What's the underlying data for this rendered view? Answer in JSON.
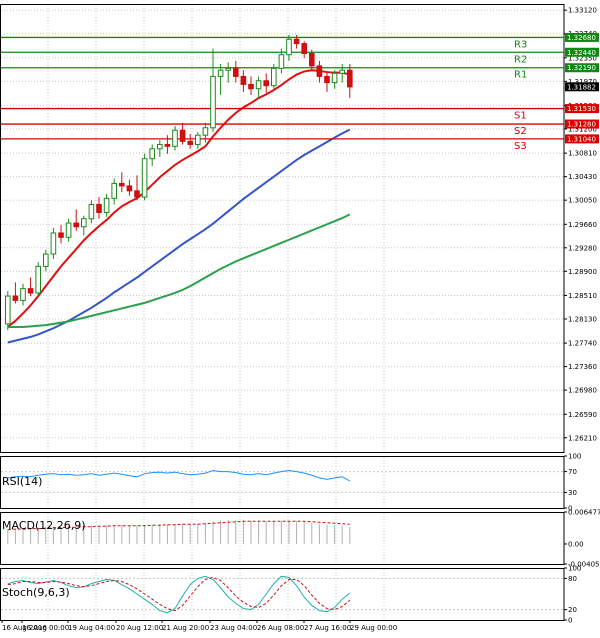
{
  "chart_data": [
    {
      "type": "candlestick",
      "name_hidden": true,
      "price_axis": {
        "ylim": [
          1.2598,
          1.3322
        ],
        "ticks": [
          "1.33120",
          "1.32740",
          "1.32350",
          "1.31970",
          "1.31580",
          "1.31200",
          "1.30810",
          "1.30430",
          "1.30050",
          "1.29660",
          "1.29280",
          "1.28900",
          "1.28510",
          "1.28130",
          "1.27740",
          "1.27360",
          "1.26980",
          "1.26590",
          "1.26210"
        ]
      },
      "levels": [
        {
          "label": "R3",
          "value": 1.3268,
          "tag": "1.32680",
          "kind": "resistance"
        },
        {
          "label": "R2",
          "value": 1.3244,
          "tag": "1.32440",
          "kind": "resistance"
        },
        {
          "label": "R1",
          "value": 1.3219,
          "tag": "1.32190",
          "kind": "resistance"
        },
        {
          "label": "S1",
          "value": 1.3153,
          "tag": "1.31530",
          "kind": "support"
        },
        {
          "label": "S2",
          "value": 1.3128,
          "tag": "1.31280",
          "kind": "support"
        },
        {
          "label": "S3",
          "value": 1.3104,
          "tag": "1.31040",
          "kind": "support"
        }
      ],
      "current_price": {
        "value": 1.31882,
        "tag": "1.31882"
      },
      "time_axis": [
        "16 Aug 2016",
        "16 Aug 00:00",
        "19 Aug 04:00",
        "20 Aug 12:00",
        "21 Aug 20:00",
        "23 Aug 04:00",
        "26 Aug 08:00",
        "27 Aug 16:00",
        "29 Aug 00:00"
      ],
      "colors": {
        "bull": "#1c8a1c",
        "bear": "#cc1111",
        "ma_fast": "#e01010",
        "ma_mid": "#3355cc",
        "ma_slow": "#2ca04c",
        "resistance": "#118811",
        "support": "#dd0000",
        "grid": "#c8c8c8"
      },
      "ohlc": [
        [
          1.2805,
          1.2858,
          1.2795,
          1.285
        ],
        [
          1.285,
          1.2872,
          1.2838,
          1.2843
        ],
        [
          1.2843,
          1.287,
          1.2835,
          1.2862
        ],
        [
          1.2862,
          1.288,
          1.285,
          1.2855
        ],
        [
          1.2855,
          1.2905,
          1.285,
          1.2898
        ],
        [
          1.2898,
          1.2925,
          1.289,
          1.2918
        ],
        [
          1.2918,
          1.296,
          1.291,
          1.2952
        ],
        [
          1.2952,
          1.2965,
          1.2935,
          1.2945
        ],
        [
          1.2945,
          1.2975,
          1.2938,
          1.2968
        ],
        [
          1.2968,
          1.299,
          1.2955,
          1.2962
        ],
        [
          1.2962,
          1.298,
          1.2948,
          1.2975
        ],
        [
          1.2975,
          1.3005,
          1.2968,
          1.2998
        ],
        [
          1.2998,
          1.301,
          1.2975,
          1.2985
        ],
        [
          1.2985,
          1.3015,
          1.2978,
          1.3008
        ],
        [
          1.3008,
          1.304,
          1.2998,
          1.3032
        ],
        [
          1.3032,
          1.305,
          1.3018,
          1.3028
        ],
        [
          1.3028,
          1.3038,
          1.3012,
          1.302
        ],
        [
          1.302,
          1.3045,
          1.3005,
          1.301
        ],
        [
          1.301,
          1.308,
          1.3005,
          1.3072
        ],
        [
          1.3072,
          1.3095,
          1.306,
          1.3088
        ],
        [
          1.3088,
          1.3102,
          1.3075,
          1.3095
        ],
        [
          1.3095,
          1.311,
          1.308,
          1.3092
        ],
        [
          1.3092,
          1.3125,
          1.3085,
          1.3118
        ],
        [
          1.3118,
          1.313,
          1.3095,
          1.31
        ],
        [
          1.31,
          1.3112,
          1.3088,
          1.3095
        ],
        [
          1.3095,
          1.3115,
          1.3088,
          1.311
        ],
        [
          1.311,
          1.313,
          1.3098,
          1.3122
        ],
        [
          1.3122,
          1.325,
          1.3115,
          1.3205
        ],
        [
          1.3205,
          1.3225,
          1.3175,
          1.3215
        ],
        [
          1.3215,
          1.3228,
          1.3195,
          1.3218
        ],
        [
          1.3218,
          1.323,
          1.3195,
          1.3205
        ],
        [
          1.3205,
          1.3215,
          1.318,
          1.3192
        ],
        [
          1.3192,
          1.3205,
          1.3175,
          1.3185
        ],
        [
          1.3185,
          1.3205,
          1.317,
          1.3198
        ],
        [
          1.3198,
          1.321,
          1.3178,
          1.319
        ],
        [
          1.319,
          1.3225,
          1.3185,
          1.3218
        ],
        [
          1.3218,
          1.325,
          1.321,
          1.324
        ],
        [
          1.324,
          1.3272,
          1.323,
          1.3265
        ],
        [
          1.3265,
          1.3272,
          1.325,
          1.3258
        ],
        [
          1.3258,
          1.3262,
          1.3235,
          1.3242
        ],
        [
          1.3242,
          1.3248,
          1.3215,
          1.3222
        ],
        [
          1.3222,
          1.323,
          1.3195,
          1.3205
        ],
        [
          1.3205,
          1.3212,
          1.318,
          1.3195
        ],
        [
          1.3195,
          1.3215,
          1.3185,
          1.321
        ],
        [
          1.321,
          1.3225,
          1.3195,
          1.3215
        ],
        [
          1.3215,
          1.3225,
          1.317,
          1.3188
        ]
      ],
      "ma_fast": [
        1.28,
        1.281,
        1.2822,
        1.2835,
        1.285,
        1.2866,
        1.2882,
        1.2898,
        1.2912,
        1.2926,
        1.294,
        1.2952,
        1.2963,
        1.2973,
        1.2985,
        1.2995,
        1.3002,
        1.3008,
        1.3018,
        1.303,
        1.3042,
        1.3052,
        1.3062,
        1.307,
        1.3077,
        1.3084,
        1.3092,
        1.3108,
        1.3122,
        1.3135,
        1.3146,
        1.3155,
        1.3162,
        1.317,
        1.3176,
        1.3183,
        1.3191,
        1.32,
        1.3208,
        1.3213,
        1.3215,
        1.3214,
        1.3212,
        1.3211,
        1.3211,
        1.3208
      ],
      "ma_mid": [
        1.2775,
        1.2778,
        1.2781,
        1.2784,
        1.2788,
        1.2793,
        1.2798,
        1.2804,
        1.281,
        1.2817,
        1.2824,
        1.2831,
        1.2839,
        1.2847,
        1.2856,
        1.2864,
        1.2872,
        1.288,
        1.2889,
        1.2898,
        1.2907,
        1.2916,
        1.2925,
        1.2934,
        1.2942,
        1.295,
        1.2958,
        1.2967,
        1.2977,
        1.2987,
        1.2997,
        1.3007,
        1.3016,
        1.3025,
        1.3034,
        1.3043,
        1.3052,
        1.3061,
        1.307,
        1.3078,
        1.3085,
        1.3092,
        1.3099,
        1.3106,
        1.3113,
        1.3119
      ],
      "ma_slow": [
        1.28,
        1.28,
        1.28,
        1.2801,
        1.2802,
        1.2803,
        1.2805,
        1.2807,
        1.2809,
        1.2812,
        1.2815,
        1.2818,
        1.2821,
        1.2824,
        1.2827,
        1.283,
        1.2833,
        1.2836,
        1.2839,
        1.2843,
        1.2847,
        1.2851,
        1.2855,
        1.286,
        1.2866,
        1.2873,
        1.288,
        1.2887,
        1.2894,
        1.29,
        1.2906,
        1.2911,
        1.2916,
        1.2921,
        1.2926,
        1.2931,
        1.2936,
        1.2941,
        1.2946,
        1.2951,
        1.2956,
        1.2961,
        1.2966,
        1.2971,
        1.2976,
        1.2982
      ]
    },
    {
      "type": "line",
      "title": "RSI(14)",
      "ticks": [
        "100",
        "70",
        "30",
        "0"
      ],
      "ylim": [
        0,
        100
      ],
      "values": [
        58,
        60,
        61,
        60,
        63,
        65,
        66,
        64,
        65,
        63,
        64,
        66,
        63,
        65,
        67,
        65,
        62,
        60,
        66,
        68,
        69,
        67,
        69,
        66,
        64,
        65,
        67,
        72,
        70,
        70,
        68,
        65,
        64,
        66,
        64,
        67,
        70,
        72,
        70,
        67,
        63,
        58,
        55,
        58,
        60,
        52
      ]
    },
    {
      "type": "bar",
      "title": "MACD(12,26,9)",
      "ticks": [
        "0.006477",
        "0.00",
        "-0.004058"
      ],
      "ylim": [
        -0.004058,
        0.006477
      ],
      "values": [
        0.003,
        0.0031,
        0.0032,
        0.0032,
        0.0033,
        0.0034,
        0.0035,
        0.0035,
        0.0036,
        0.0036,
        0.0037,
        0.0037,
        0.0037,
        0.0038,
        0.0038,
        0.0038,
        0.0037,
        0.0037,
        0.0038,
        0.0039,
        0.004,
        0.004,
        0.0041,
        0.0041,
        0.0041,
        0.0041,
        0.0042,
        0.0045,
        0.0047,
        0.0048,
        0.0048,
        0.0048,
        0.0047,
        0.0047,
        0.0046,
        0.0046,
        0.0046,
        0.0047,
        0.0046,
        0.0045,
        0.0043,
        0.0041,
        0.0039,
        0.0038,
        0.0037,
        0.0035
      ],
      "signal": [
        0.0029,
        0.003,
        0.003,
        0.0031,
        0.0031,
        0.0032,
        0.0033,
        0.0033,
        0.0034,
        0.0034,
        0.0035,
        0.0035,
        0.0036,
        0.0036,
        0.0037,
        0.0037,
        0.0037,
        0.0037,
        0.0037,
        0.0038,
        0.0038,
        0.0039,
        0.0039,
        0.004,
        0.004,
        0.004,
        0.0041,
        0.0042,
        0.0043,
        0.0044,
        0.0045,
        0.0046,
        0.0046,
        0.0046,
        0.0046,
        0.0046,
        0.0046,
        0.0046,
        0.0046,
        0.0046,
        0.0045,
        0.0044,
        0.0043,
        0.0042,
        0.0041,
        0.004
      ]
    },
    {
      "type": "line",
      "title": "Stoch(9,6,3)",
      "ticks": [
        "100",
        "80",
        "20",
        "0"
      ],
      "ylim": [
        0,
        100
      ],
      "main": [
        70,
        74,
        76,
        72,
        70,
        73,
        76,
        72,
        66,
        62,
        64,
        70,
        74,
        78,
        76,
        68,
        60,
        50,
        40,
        30,
        18,
        14,
        22,
        46,
        68,
        80,
        84,
        78,
        62,
        44,
        32,
        22,
        20,
        30,
        50,
        70,
        84,
        82,
        66,
        44,
        28,
        18,
        16,
        24,
        40,
        52
      ],
      "signal": [
        68,
        70,
        74,
        74,
        72,
        72,
        74,
        73,
        70,
        66,
        64,
        66,
        70,
        74,
        76,
        74,
        68,
        60,
        50,
        40,
        30,
        22,
        18,
        28,
        46,
        64,
        78,
        82,
        76,
        62,
        46,
        34,
        26,
        24,
        32,
        48,
        66,
        78,
        78,
        66,
        48,
        32,
        22,
        20,
        26,
        38
      ]
    }
  ]
}
